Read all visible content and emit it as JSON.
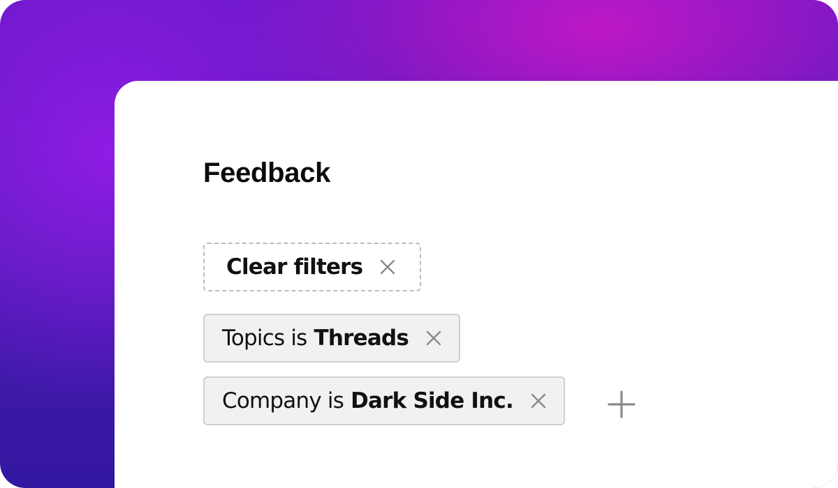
{
  "page": {
    "title": "Feedback"
  },
  "filters": {
    "clear_label": "Clear filters",
    "items": [
      {
        "field": "Topics is",
        "value": "Threads"
      },
      {
        "field": "Company is",
        "value": "Dark Side Inc."
      }
    ]
  },
  "icons": {
    "remove": "close-icon",
    "add": "plus-icon"
  },
  "colors": {
    "gradient_purple": "#6818c8",
    "gradient_magenta": "#cd18c4",
    "gradient_indigo": "#3317a0",
    "chip_background": "#f1f1f1",
    "chip_border": "#cfcfcf",
    "icon_gray": "#8a8a8a",
    "text": "#111111"
  }
}
